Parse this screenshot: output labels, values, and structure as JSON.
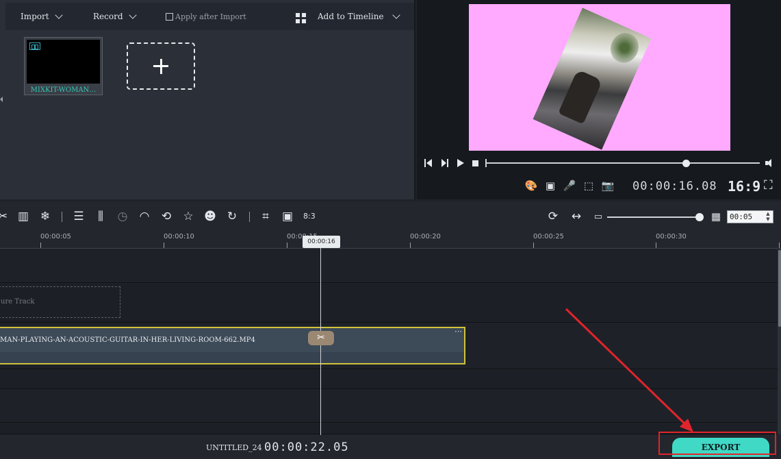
{
  "media_toolbar": {
    "import_label": "Import",
    "record_label": "Record",
    "apply_after_import_label": "Apply after Import",
    "add_to_timeline_label": "Add to Timeline",
    "grid_icon": "grid-icon"
  },
  "media_library": {
    "clip_label": "MIXKIT-WOMAN…",
    "add_icon": "plus-icon"
  },
  "preview": {
    "background_color": "#ffaaff",
    "time": "00:00:16.08",
    "aspect_ratio": "16:9",
    "seek_progress": 0.72,
    "controls": [
      "prev-frame-icon",
      "next-frame-icon",
      "play-icon",
      "stop-icon"
    ],
    "tools": [
      "palette-icon",
      "camera-record-icon",
      "microphone-icon",
      "screenshot-region-icon",
      "snapshot-camera-icon"
    ]
  },
  "timeline_toolbar": {
    "ratio_label": "8:3",
    "zoom_value": "00:05",
    "zoom_level": 0.95,
    "tools": [
      "cut-icon",
      "split-clip-icon",
      "freeze-icon",
      "adjust-icon",
      "columns-icon",
      "clock-icon",
      "speedometer-icon",
      "rotate-icon",
      "star-icon",
      "person-icon",
      "loop-icon",
      "crop-icon",
      "pip-icon"
    ]
  },
  "ruler": {
    "labels": [
      "00:00:05",
      "00:00:10",
      "00:00:15",
      "00:00:20",
      "00:00:25",
      "00:00:30"
    ]
  },
  "playhead": {
    "time": "00:00:16"
  },
  "tracks": {
    "feature_track_label": "ure Track",
    "clip_name": "MAN-PLAYING-AN-ACOUSTIC-GUITAR-IN-HER-LIVING-ROOM-662.MP4",
    "clip_more": "⋯",
    "clip_border_color": "#d3c33c"
  },
  "status_bar": {
    "project_name": "UNTITLED_24",
    "duration": "00:00:22.05",
    "export_label": "EXPORT",
    "export_color": "#3fd9c6"
  }
}
